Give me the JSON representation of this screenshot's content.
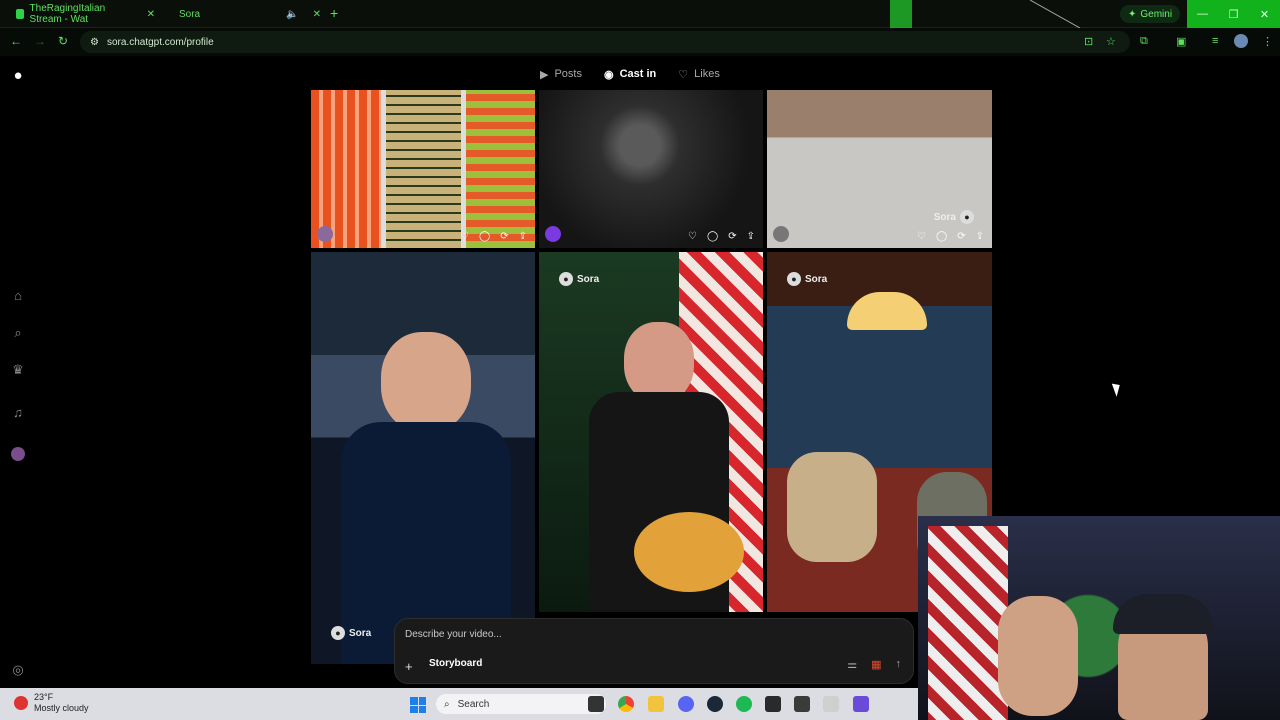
{
  "browser": {
    "tabs": [
      {
        "title": "TheRagingItalian Stream - Wat",
        "color": "#2fd14a"
      },
      {
        "title": "Sora",
        "color": "#4a7bd9"
      }
    ],
    "new_tab": "+",
    "gemini_label": "Gemini",
    "url": "sora.chatgpt.com/profile",
    "accent": "#5ee05e"
  },
  "profile_tabs": [
    {
      "label": "Posts",
      "icon": "play-square-icon"
    },
    {
      "label": "Cast in",
      "icon": "person-circle-icon"
    },
    {
      "label": "Likes",
      "icon": "heart-icon"
    }
  ],
  "sidebar": [
    "home-icon",
    "search-icon",
    "trophy-icon",
    "bell-icon",
    "avatar"
  ],
  "watermark": {
    "brand": "Sora"
  },
  "prompt": {
    "placeholder": "Describe your video...",
    "storyboard_label": "Storyboard"
  },
  "taskbar": {
    "weather_temp": "23°F",
    "weather_desc": "Mostly cloudy",
    "search_label": "Search"
  }
}
